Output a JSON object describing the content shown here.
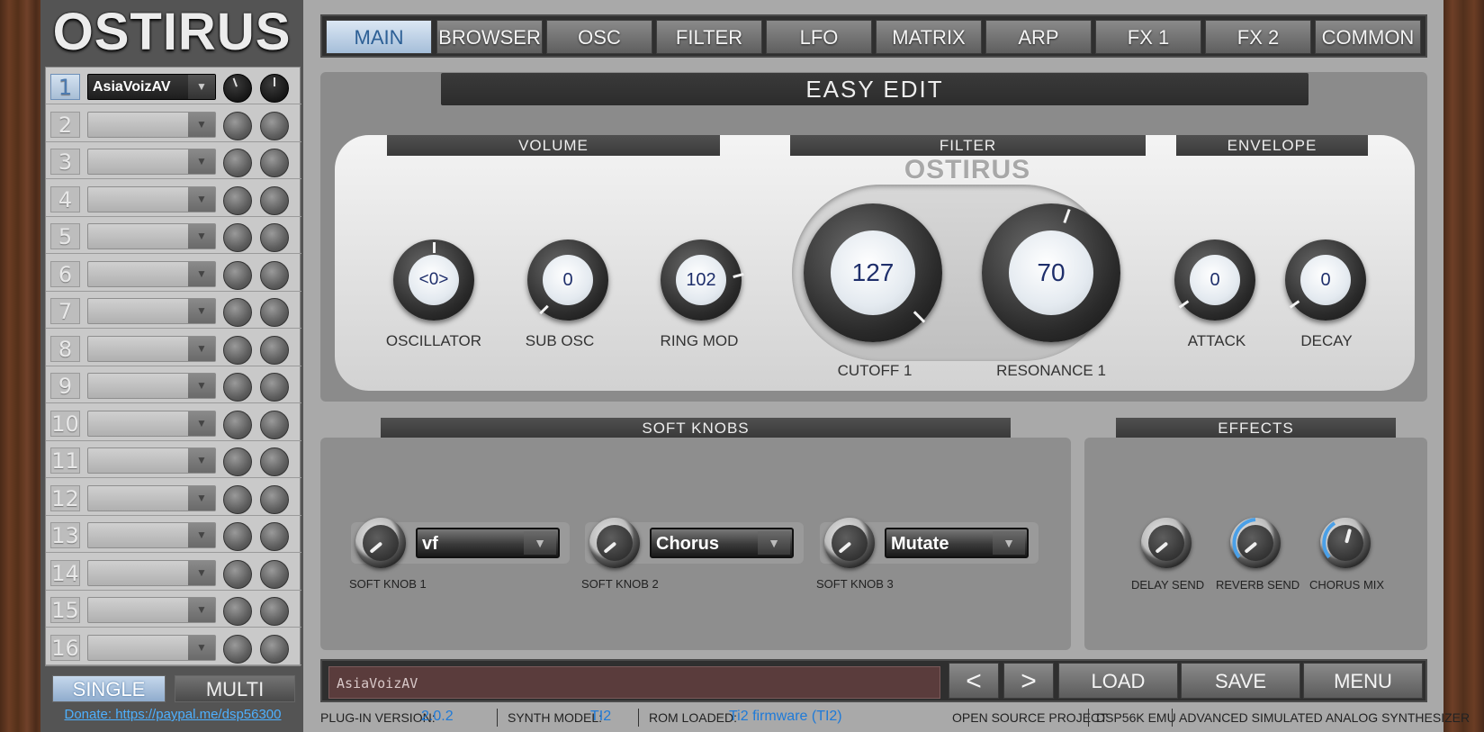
{
  "app": {
    "logo": "OSTIRUS"
  },
  "tabs": [
    "MAIN",
    "BROWSER",
    "OSC",
    "FILTER",
    "LFO",
    "MATRIX",
    "ARP",
    "FX 1",
    "FX 2",
    "COMMON"
  ],
  "active_tab": "MAIN",
  "parts": {
    "numbers": [
      "1",
      "2",
      "3",
      "4",
      "5",
      "6",
      "7",
      "8",
      "9",
      "10",
      "11",
      "12",
      "13",
      "14",
      "15",
      "16"
    ],
    "active": 0,
    "active_patch": "AsiaVoizAV"
  },
  "mode": {
    "single": "SINGLE",
    "multi": "MULTI",
    "selected": "SINGLE"
  },
  "donate": "Donate: https://paypal.me/dsp56300",
  "easy_edit": {
    "title": "EASY EDIT",
    "sections": {
      "volume": "VOLUME",
      "filter": "FILTER",
      "envelope": "ENVELOPE"
    },
    "filter_logo": "OSTIRUS",
    "knobs": {
      "oscillator": {
        "label": "OSCILLATOR",
        "value": "<0>"
      },
      "sub_osc": {
        "label": "SUB OSC",
        "value": "0"
      },
      "ring_mod": {
        "label": "RING MOD",
        "value": "102"
      },
      "cutoff": {
        "label": "CUTOFF 1",
        "value": "127"
      },
      "resonance": {
        "label": "RESONANCE 1",
        "value": "70"
      },
      "attack": {
        "label": "ATTACK",
        "value": "0"
      },
      "decay": {
        "label": "DECAY",
        "value": "0"
      }
    }
  },
  "soft_knobs": {
    "title": "SOFT KNOBS",
    "items": [
      {
        "label": "SOFT KNOB 1",
        "assign": "vf"
      },
      {
        "label": "SOFT KNOB 2",
        "assign": "Chorus"
      },
      {
        "label": "SOFT KNOB 3",
        "assign": "Mutate"
      }
    ]
  },
  "effects": {
    "title": "EFFECTS",
    "items": [
      {
        "label": "DELAY SEND"
      },
      {
        "label": "REVERB SEND"
      },
      {
        "label": "CHORUS MIX"
      }
    ]
  },
  "bottom": {
    "patch_name": "AsiaVoizAV",
    "prev": "<",
    "next": ">",
    "load": "LOAD",
    "save": "SAVE",
    "menu": "MENU"
  },
  "status": {
    "plugin_label": "PLUG-IN VERSION:",
    "plugin_value": "2.0.2",
    "synth_label": "SYNTH MODEL:",
    "synth_value": "TI2",
    "rom_label": "ROM LOADED:",
    "rom_value": "Ti2 firmware (TI2)",
    "open_source": "OPEN SOURCE PROJECT",
    "emu": "DSP56K EMU",
    "desc": "ADVANCED SIMULATED ANALOG SYNTHESIZER"
  },
  "colors": {
    "accent": "#1e7ad8",
    "active_tab": "#2c5f95"
  }
}
